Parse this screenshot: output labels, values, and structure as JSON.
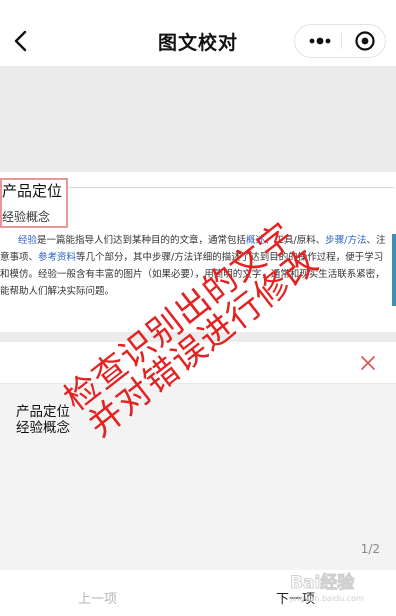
{
  "nav": {
    "title": "图文校对",
    "back_icon": "chevron-left-icon",
    "more_icon": "more-dots-icon",
    "close_icon": "target-circle-icon"
  },
  "document_preview": {
    "heading": "产品定位",
    "subheading": "经验概念",
    "paragraph": {
      "t1": "经验",
      "t2": "是一篇能指导人们达到某种目的的文章，通常包括",
      "t3": "概述",
      "t4": "、工具/原料、",
      "t5": "步骤/方法",
      "t6": "、注意事项、",
      "t7": "参考资料",
      "t8": "等几个部分，其中步骤/方法详细的描述了达到目的的操作过程，便于学习和模仿。经验一般含有丰富的图片（如果必要），用简明的文字，通常和现实生活联系紧密，能帮助人们解决实际问题。"
    },
    "highlight_color": "#e89797",
    "link_color": "#2a62c9"
  },
  "correction_input": {
    "value": "",
    "clear_icon": "close-x-icon",
    "clear_color": "#e05a5a"
  },
  "result": {
    "line1": "产品定位",
    "line2": "经验概念",
    "pager": "1/2"
  },
  "bottom": {
    "prev_label": "上一项",
    "next_label": "下一项"
  },
  "annotation": {
    "line1": "检查识别出的文字",
    "line2": "并对错误进行修改",
    "color": "#e32222"
  },
  "watermark": {
    "text": "Bai经验",
    "sub": "jingyan.baidu.com"
  }
}
